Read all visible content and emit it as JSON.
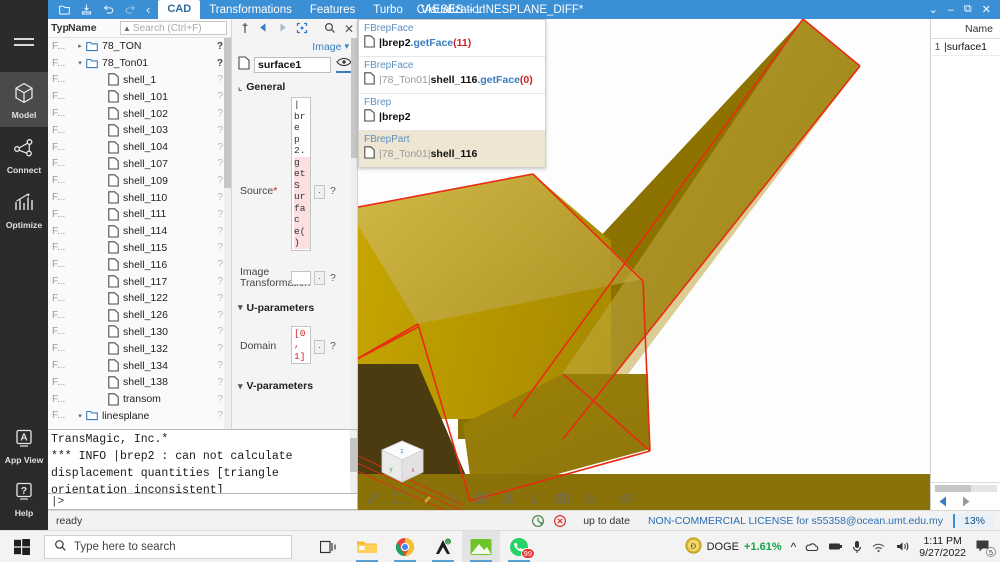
{
  "titlebar": {
    "icons": [
      "open-icon",
      "save-icon",
      "undo-icon",
      "redo-icon",
      "back-chevron-icon"
    ],
    "active_tab": "CAD",
    "menus": [
      "Transformations",
      "Features",
      "Turbo",
      "Visualization"
    ],
    "app_title": "CAESES – LINESPLANE_DIFF*",
    "window_controls": [
      "⌄",
      "–",
      "⧉",
      "✕"
    ]
  },
  "rail": {
    "items": [
      {
        "label": "Model",
        "icon": "cube-icon",
        "active": true
      },
      {
        "label": "Connect",
        "icon": "nodes-icon",
        "active": false
      },
      {
        "label": "Optimize",
        "icon": "bar-chart-icon",
        "active": false
      },
      {
        "label": "App View",
        "icon": "letter-a-icon",
        "active": false
      },
      {
        "label": "Help",
        "icon": "question-mark-icon",
        "active": false
      }
    ]
  },
  "tree": {
    "columns": {
      "type": "Typ",
      "name": "Name"
    },
    "search_placeholder": "Search (Ctrl+F)",
    "rows": [
      {
        "type": "F...",
        "name": "78_TON",
        "indent": 0,
        "arrow": "▸",
        "icon": "folder-icon",
        "flag": "?",
        "flag_dark": true
      },
      {
        "type": "F...",
        "name": "78_Ton01",
        "indent": 0,
        "arrow": "▾",
        "icon": "folder-icon",
        "flag": "?",
        "flag_dark": true
      },
      {
        "type": "F...",
        "name": "shell_1",
        "indent": 1,
        "arrow": "",
        "icon": "file-icon",
        "flag": "?",
        "flag_dark": false
      },
      {
        "type": "F...",
        "name": "shell_101",
        "indent": 1,
        "arrow": "",
        "icon": "file-icon",
        "flag": "?",
        "flag_dark": false
      },
      {
        "type": "F...",
        "name": "shell_102",
        "indent": 1,
        "arrow": "",
        "icon": "file-icon",
        "flag": "?",
        "flag_dark": false
      },
      {
        "type": "F...",
        "name": "shell_103",
        "indent": 1,
        "arrow": "",
        "icon": "file-icon",
        "flag": "?",
        "flag_dark": false
      },
      {
        "type": "F...",
        "name": "shell_104",
        "indent": 1,
        "arrow": "",
        "icon": "file-icon",
        "flag": "?",
        "flag_dark": false
      },
      {
        "type": "F...",
        "name": "shell_107",
        "indent": 1,
        "arrow": "",
        "icon": "file-icon",
        "flag": "?",
        "flag_dark": false
      },
      {
        "type": "F...",
        "name": "shell_109",
        "indent": 1,
        "arrow": "",
        "icon": "file-icon",
        "flag": "?",
        "flag_dark": false
      },
      {
        "type": "F...",
        "name": "shell_110",
        "indent": 1,
        "arrow": "",
        "icon": "file-icon",
        "flag": "?",
        "flag_dark": false
      },
      {
        "type": "F...",
        "name": "shell_111",
        "indent": 1,
        "arrow": "",
        "icon": "file-icon",
        "flag": "?",
        "flag_dark": false
      },
      {
        "type": "F...",
        "name": "shell_114",
        "indent": 1,
        "arrow": "",
        "icon": "file-icon",
        "flag": "?",
        "flag_dark": false
      },
      {
        "type": "F...",
        "name": "shell_115",
        "indent": 1,
        "arrow": "",
        "icon": "file-icon",
        "flag": "?",
        "flag_dark": false
      },
      {
        "type": "F...",
        "name": "shell_116",
        "indent": 1,
        "arrow": "",
        "icon": "file-icon",
        "flag": "?",
        "flag_dark": false
      },
      {
        "type": "F...",
        "name": "shell_117",
        "indent": 1,
        "arrow": "",
        "icon": "file-icon",
        "flag": "?",
        "flag_dark": false
      },
      {
        "type": "F...",
        "name": "shell_122",
        "indent": 1,
        "arrow": "",
        "icon": "file-icon",
        "flag": "?",
        "flag_dark": false
      },
      {
        "type": "F...",
        "name": "shell_126",
        "indent": 1,
        "arrow": "",
        "icon": "file-icon",
        "flag": "?",
        "flag_dark": false
      },
      {
        "type": "F...",
        "name": "shell_130",
        "indent": 1,
        "arrow": "",
        "icon": "file-icon",
        "flag": "?",
        "flag_dark": false
      },
      {
        "type": "F...",
        "name": "shell_132",
        "indent": 1,
        "arrow": "",
        "icon": "file-icon",
        "flag": "?",
        "flag_dark": false
      },
      {
        "type": "F...",
        "name": "shell_134",
        "indent": 1,
        "arrow": "",
        "icon": "file-icon",
        "flag": "?",
        "flag_dark": false
      },
      {
        "type": "F...",
        "name": "shell_138",
        "indent": 1,
        "arrow": "",
        "icon": "file-icon",
        "flag": "?",
        "flag_dark": false
      },
      {
        "type": "F...",
        "name": "transom",
        "indent": 1,
        "arrow": "",
        "icon": "file-icon",
        "flag": "?",
        "flag_dark": false
      },
      {
        "type": "F...",
        "name": "linesplane",
        "indent": 0,
        "arrow": "▾",
        "icon": "folder-icon",
        "flag": "?",
        "flag_dark": false
      }
    ]
  },
  "console": {
    "lines": [
      "TransMagic, Inc.*",
      "*** INFO |brep2 : can not calculate",
      "displacement quantities [triangle",
      "orientation inconsistent]"
    ],
    "prompt": "|>"
  },
  "properties": {
    "toolbar_icons": [
      "pin-icon",
      "back-arrow-icon",
      "forward-arrow-icon",
      "expand-icon",
      "search-icon",
      "close-icon"
    ],
    "type_selector": "Image",
    "object_name": "surface1",
    "sections": [
      {
        "label": "General",
        "expanded": true
      },
      {
        "label": "U-parameters",
        "expanded": true
      },
      {
        "label": "V-parameters",
        "expanded": true
      }
    ],
    "fields": [
      {
        "label": "Source",
        "required": true,
        "value": "|brep2.getSurface()",
        "chars": [
          "|",
          "br",
          "e",
          "p",
          "2.",
          "g",
          "et",
          "S",
          "ur",
          "fa",
          "c",
          "e(",
          ")"
        ],
        "hl_from": 5
      },
      {
        "label": "Image Transformation",
        "required": false,
        "value": "",
        "chars": [],
        "hl_from": 99
      },
      {
        "label": "Domain",
        "required": false,
        "value": "[0, 1]",
        "chars": [
          "[0",
          ",",
          "1]"
        ],
        "hl_from": 99
      }
    ]
  },
  "autocomplete": {
    "items": [
      {
        "type": "FBrepFace",
        "path": "",
        "name": "|brep2",
        "method": ".getFace",
        "arg": "(11)",
        "selected": false
      },
      {
        "type": "FBrepFace",
        "path": "|78_Ton01|",
        "name": "shell_116",
        "method": ".getFace",
        "arg": "(0)",
        "selected": false
      },
      {
        "type": "FBrep",
        "path": "",
        "name": "|brep2",
        "method": "",
        "arg": "",
        "selected": false
      },
      {
        "type": "FBrepPart",
        "path": "|78_Ton01|",
        "name": "shell_116",
        "method": "",
        "arg": "",
        "selected": true
      }
    ]
  },
  "viewport": {
    "toolbar_icons": [
      "pencil-icon",
      "fit-icon",
      "highlight-icon",
      "cursor-icon",
      "split-view-icon",
      "mirror-icon",
      "measure-icon",
      "camera-icon",
      "grid-icon",
      "eye-icon"
    ],
    "nav_cube": "navigation-cube-icon",
    "colors": {
      "face_light": "#d4b000",
      "face_mid": "#b39200",
      "face_dark": "#8f7400",
      "face_shadow": "#4a3c10",
      "edge": "#e82b12",
      "highlight_overlay": "#ece0c6"
    }
  },
  "right_panel": {
    "header": "Name",
    "rows": [
      {
        "index": "1",
        "value": "|surface1"
      }
    ]
  },
  "statusbar": {
    "status": "ready",
    "history_icon": "history-icon",
    "error_icon": "error-icon",
    "sync_state": "up to date",
    "license": "NON-COMMERCIAL LICENSE for s55358@ocean.umt.edu.my",
    "zoom": "13%"
  },
  "taskbar": {
    "start_icon": "windows-start-icon",
    "search_placeholder": "Type here to search",
    "taskview_icon": "task-view-icon",
    "apps": [
      {
        "name": "file-explorer-icon",
        "running": true
      },
      {
        "name": "chrome-icon",
        "running": true
      },
      {
        "name": "dark-app-icon",
        "running": true
      },
      {
        "name": "green-mountain-icon",
        "running": true,
        "active": true
      },
      {
        "name": "whatsapp-icon",
        "running": true,
        "badge": "99"
      }
    ],
    "tray": {
      "doge_label": "DOGE",
      "doge_change": "+1.61%",
      "chevron": "⌃",
      "icons": [
        "onedrive-icon",
        "usb-icon",
        "microphone-icon",
        "wifi-icon",
        "volume-icon"
      ],
      "time": "1:11 PM",
      "date": "9/27/2022",
      "notification_count": "5"
    }
  }
}
